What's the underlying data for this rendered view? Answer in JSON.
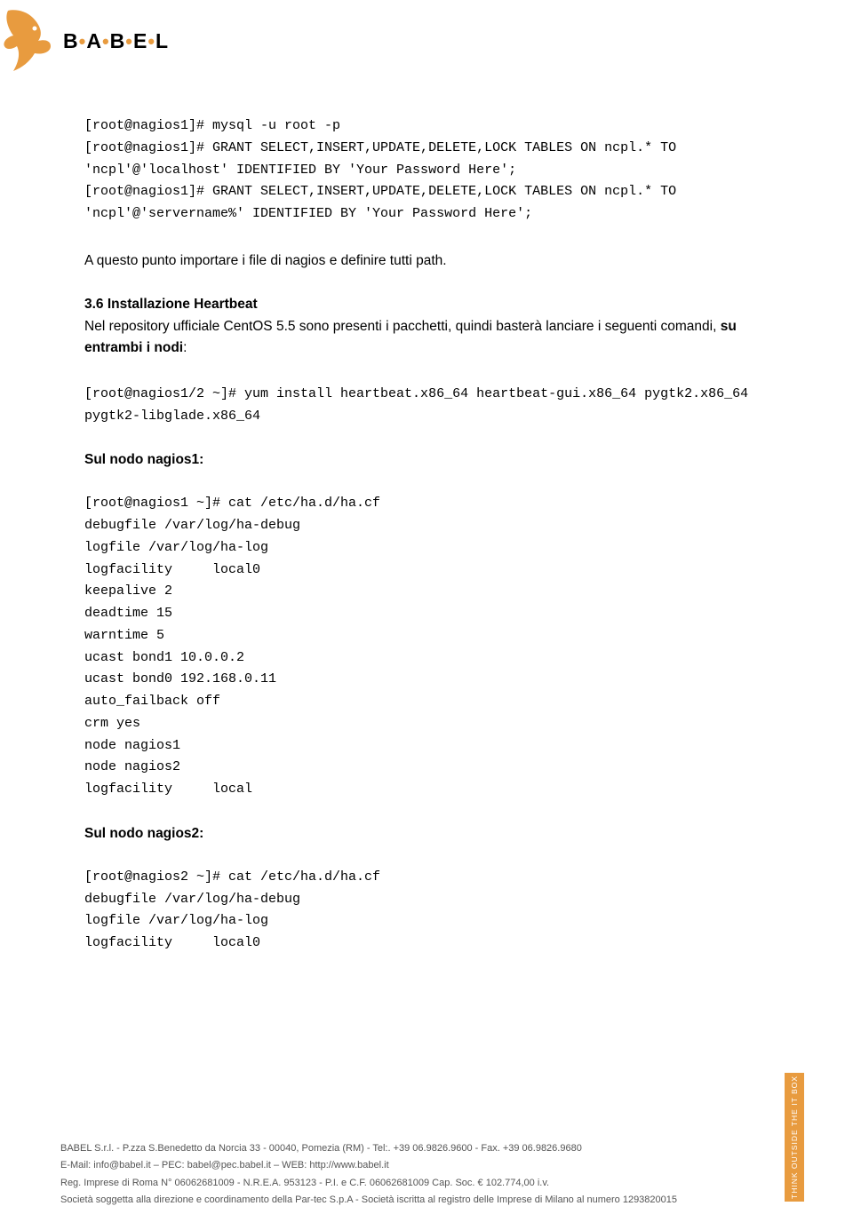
{
  "logo": {
    "text_parts": [
      "B",
      "A",
      "B",
      "E",
      "L"
    ]
  },
  "code_block_1": "[root@nagios1]# mysql -u root -p\n[root@nagios1]# GRANT SELECT,INSERT,UPDATE,DELETE,LOCK TABLES ON ncpl.* TO 'ncpl'@'localhost' IDENTIFIED BY 'Your Password Here';\n[root@nagios1]# GRANT SELECT,INSERT,UPDATE,DELETE,LOCK TABLES ON ncpl.* TO 'ncpl'@'servername%' IDENTIFIED BY 'Your Password Here';",
  "para_1": "A questo punto importare i file di nagios e definire tutti path.",
  "heading_1": "3.6 Installazione Heartbeat",
  "para_2_a": "Nel repository ufficiale CentOS 5.5 sono presenti i pacchetti, quindi basterà lanciare i seguenti comandi, ",
  "para_2_b": "su entrambi i nodi",
  "para_2_c": ":",
  "code_block_2": "[root@nagios1/2 ~]# yum install heartbeat.x86_64 heartbeat-gui.x86_64 pygtk2.x86_64 pygtk2-libglade.x86_64",
  "heading_2": "Sul nodo nagios1:",
  "code_block_3": "[root@nagios1 ~]# cat /etc/ha.d/ha.cf\ndebugfile /var/log/ha-debug\nlogfile /var/log/ha-log\nlogfacility     local0\nkeepalive 2\ndeadtime 15\nwarntime 5\nucast bond1 10.0.0.2\nucast bond0 192.168.0.11\nauto_failback off\ncrm yes\nnode nagios1\nnode nagios2\nlogfacility     local",
  "heading_3": "Sul nodo nagios2:",
  "code_block_4": "[root@nagios2 ~]# cat /etc/ha.d/ha.cf\ndebugfile /var/log/ha-debug\nlogfile /var/log/ha-log\nlogfacility     local0",
  "footer": {
    "line1": "BABEL S.r.l. - P.zza S.Benedetto da Norcia 33 - 00040, Pomezia (RM) - Tel:. +39 06.9826.9600 - Fax. +39 06.9826.9680",
    "line2": "E-Mail: info@babel.it – PEC: babel@pec.babel.it – WEB: http://www.babel.it",
    "line3": "Reg. Imprese di Roma N° 06062681009 - N.R.E.A. 953123 - P.I. e C.F. 06062681009 Cap. Soc. € 102.774,00 i.v.",
    "line4": "Società soggetta alla direzione e coordinamento della Par-tec S.p.A - Società iscritta al registro delle Imprese di Milano al numero 1293820015"
  },
  "side_tag": "THINK OUTSIDE THE IT BOX"
}
